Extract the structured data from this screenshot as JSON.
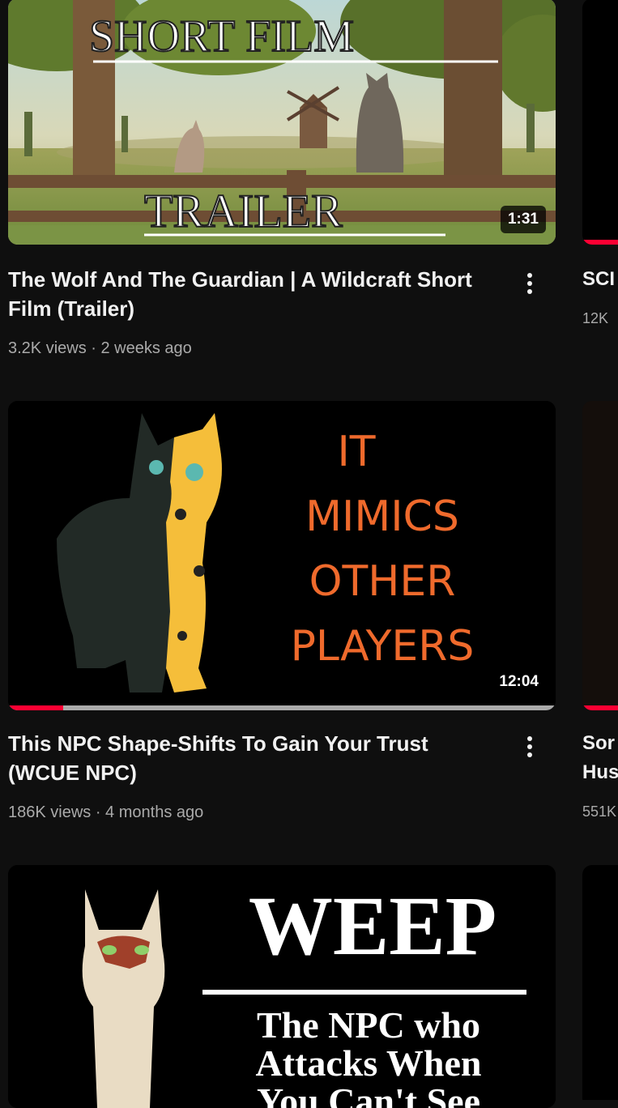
{
  "videos": [
    {
      "title": "The Wolf And The Guardian | A Wildcraft Short Film (Trailer)",
      "meta": "3.2K views · 2 weeks ago",
      "duration": "1:31",
      "thumb_text": {
        "top": "SHORT FILM",
        "bottom": "TRAILER"
      }
    },
    {
      "title": "This NPC Shape-Shifts To Gain Your Trust (WCUE NPC)",
      "meta": "186K views · 4 months ago",
      "duration": "12:04",
      "watch_progress": 0.1,
      "thumb_text": {
        "line1": "IT",
        "line2": "MIMICS",
        "line3": "OTHER",
        "line4": "PLAYERS"
      }
    },
    {
      "thumb_text": {
        "headline": "WEEP",
        "sub1": "The NPC who",
        "sub2": "Attacks When",
        "sub3": "You Can't See"
      }
    }
  ],
  "peek": [
    {
      "title": "SCI",
      "meta": "12K"
    },
    {
      "title1": "Sor",
      "title2": "Hus",
      "meta": "551K"
    }
  ],
  "colors": {
    "background": "#0f0f0f",
    "accent_red": "#ff0033",
    "orange_text": "#ef6a2c"
  }
}
